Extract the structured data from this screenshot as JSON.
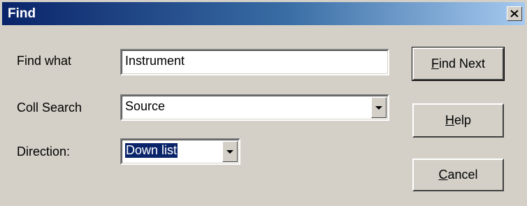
{
  "window": {
    "title": "Find",
    "close_glyph": "×"
  },
  "form": {
    "find_what_label": "Find what",
    "find_what_value": "Instrument",
    "coll_search_label": "Coll Search",
    "coll_search_value": "Source",
    "direction_label": "Direction:",
    "direction_value": "Down list"
  },
  "buttons": {
    "find_next": {
      "accel": "F",
      "rest": "ind Next"
    },
    "help": {
      "accel": "H",
      "rest": "elp"
    },
    "cancel": {
      "accel": "C",
      "rest": "ancel"
    }
  },
  "colors": {
    "title_start": "#0a246a",
    "title_end": "#a6caf0",
    "face": "#d4d0c8",
    "selection": "#0a246a"
  },
  "icons": {
    "close": "close-icon",
    "dropdown": "chevron-down-icon"
  }
}
